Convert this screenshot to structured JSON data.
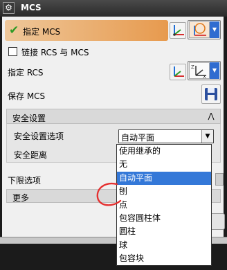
{
  "window": {
    "title": "MCS"
  },
  "specify": {
    "label": "指定 MCS"
  },
  "link_checkbox": {
    "label": "链接 RCS 与 MCS"
  },
  "specify_rcs": {
    "label": "指定 RCS"
  },
  "save_mcs": {
    "label": "保存 MCS"
  },
  "safety_group": {
    "title": "安全设置",
    "option_label": "安全设置选项",
    "distance_label": "安全距离",
    "selected": "自动平面",
    "options": [
      "使用继承的",
      "无",
      "自动平面",
      "刨",
      "点",
      "包容圆柱体",
      "圆柱",
      "球",
      "包容块"
    ],
    "highlighted_index": 2
  },
  "lower_limit": {
    "label": "下限选项"
  },
  "more": {
    "label": "更多"
  },
  "colors": {
    "selection": "#3478d8",
    "accent": "#e79a4e",
    "annotation": "#e53030"
  },
  "icons": [
    "gear-icon",
    "checkmark-icon",
    "csys-dialog-icon",
    "csys-dropdown-icon",
    "csys-orient-icon",
    "save-disk-icon",
    "chevron-up-icon",
    "chevron-down-icon"
  ]
}
